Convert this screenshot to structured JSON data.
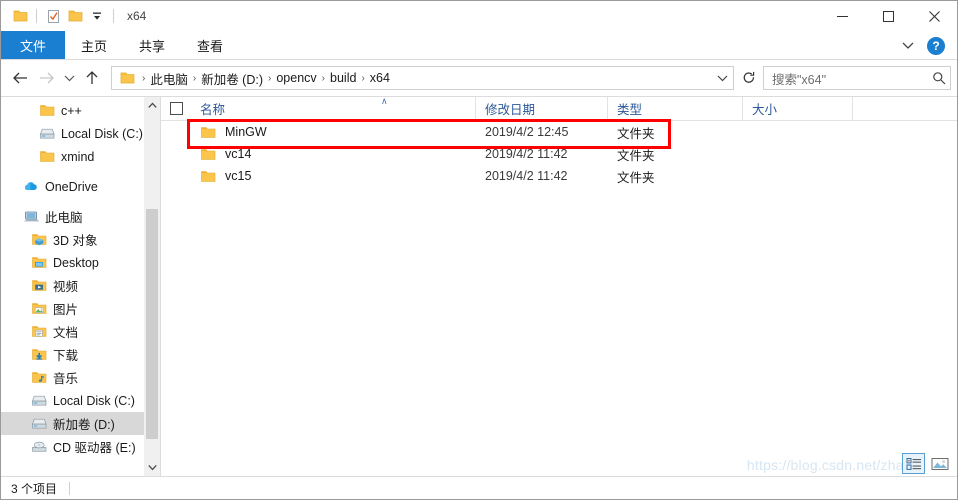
{
  "window": {
    "title": "x64",
    "quick_access": [
      {
        "name": "folder-icon",
        "label": "文件夹"
      },
      {
        "name": "properties-icon",
        "label": "属性"
      },
      {
        "name": "new-folder-icon",
        "label": "新建文件夹"
      },
      {
        "name": "customize-dropdown-icon",
        "label": "自定义快速访问工具栏"
      }
    ],
    "controls": {
      "minimize": "—",
      "maximize": "□",
      "close": "✕"
    }
  },
  "ribbon": {
    "tabs": [
      {
        "label": "文件",
        "active": true
      },
      {
        "label": "主页",
        "active": false
      },
      {
        "label": "共享",
        "active": false
      },
      {
        "label": "查看",
        "active": false
      }
    ],
    "collapse_label": "⌄",
    "help_label": "?"
  },
  "address": {
    "back_label": "←",
    "forward_label": "→",
    "recent_label": "⌄",
    "up_label": "↑",
    "breadcrumb": [
      "此电脑",
      "新加卷 (D:)",
      "opencv",
      "build",
      "x64"
    ],
    "separator": "›",
    "dropdown_label": "⌄",
    "refresh_label": "↻"
  },
  "search": {
    "placeholder": "搜索\"x64\"",
    "icon": "search-icon"
  },
  "sidebar": {
    "items": [
      {
        "label": "c++",
        "icon": "folder-icon",
        "indent": 2,
        "selected": false,
        "gap_before": false
      },
      {
        "label": "Local Disk (C:)",
        "icon": "drive-icon",
        "indent": 2,
        "selected": false,
        "gap_before": false
      },
      {
        "label": "xmind",
        "icon": "folder-icon",
        "indent": 2,
        "selected": false,
        "gap_before": false
      },
      {
        "label": "OneDrive",
        "icon": "cloud-icon",
        "indent": 0,
        "selected": false,
        "gap_before": true
      },
      {
        "label": "此电脑",
        "icon": "computer-icon",
        "indent": 0,
        "selected": false,
        "gap_before": true
      },
      {
        "label": "3D 对象",
        "icon": "3d-objects-icon",
        "indent": 1,
        "selected": false,
        "gap_before": false
      },
      {
        "label": "Desktop",
        "icon": "desktop-icon",
        "indent": 1,
        "selected": false,
        "gap_before": false
      },
      {
        "label": "视频",
        "icon": "videos-icon",
        "indent": 1,
        "selected": false,
        "gap_before": false
      },
      {
        "label": "图片",
        "icon": "pictures-icon",
        "indent": 1,
        "selected": false,
        "gap_before": false
      },
      {
        "label": "文档",
        "icon": "documents-icon",
        "indent": 1,
        "selected": false,
        "gap_before": false
      },
      {
        "label": "下载",
        "icon": "downloads-icon",
        "indent": 1,
        "selected": false,
        "gap_before": false
      },
      {
        "label": "音乐",
        "icon": "music-icon",
        "indent": 1,
        "selected": false,
        "gap_before": false
      },
      {
        "label": "Local Disk (C:)",
        "icon": "drive-icon",
        "indent": 1,
        "selected": false,
        "gap_before": false
      },
      {
        "label": "新加卷 (D:)",
        "icon": "drive-icon",
        "indent": 1,
        "selected": true,
        "gap_before": false
      },
      {
        "label": "CD 驱动器 (E:)",
        "icon": "cd-drive-icon",
        "indent": 1,
        "selected": false,
        "gap_before": false
      }
    ],
    "scroll_up": "∧",
    "scroll_down": "∨"
  },
  "filelist": {
    "columns": [
      "名称",
      "修改日期",
      "类型",
      "大小"
    ],
    "sort_indicator": "∧",
    "rows": [
      {
        "name": "MinGW",
        "date": "2019/4/2 12:45",
        "type": "文件夹",
        "size": "",
        "highlighted": true
      },
      {
        "name": "vc14",
        "date": "2019/4/2 11:42",
        "type": "文件夹",
        "size": "",
        "highlighted": false
      },
      {
        "name": "vc15",
        "date": "2019/4/2 11:42",
        "type": "文件夹",
        "size": "",
        "highlighted": false
      }
    ]
  },
  "statusbar": {
    "item_count": "3 个项目",
    "views": [
      {
        "name": "details-view-button",
        "active": true
      },
      {
        "name": "large-icons-view-button",
        "active": false
      }
    ]
  },
  "watermark": {
    "text": "https://blog.csdn.net/zhai"
  },
  "colors": {
    "accent": "#1b7fd1",
    "highlight": "#ff0000",
    "folder": "#fbc54c",
    "column_header": "#2b579a",
    "selection": "#d8d8d8"
  }
}
